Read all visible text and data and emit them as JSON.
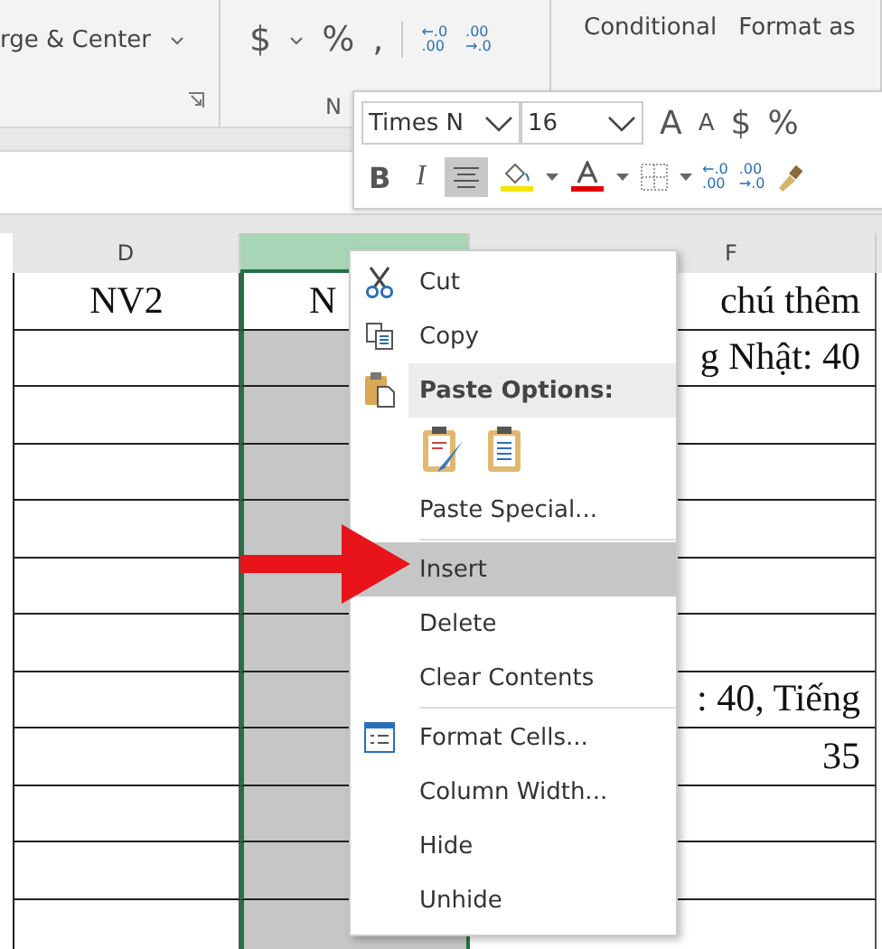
{
  "ribbon": {
    "merge_label": "rge & Center",
    "currency": "$",
    "percent": "%",
    "comma": ",",
    "decimals": [
      {
        "top": "←.0",
        "bottom": ".00"
      },
      {
        "top": ".00",
        "bottom": "→.0"
      }
    ],
    "group_label": "N",
    "styles": [
      "Conditional",
      "Format as"
    ]
  },
  "mini_toolbar": {
    "font": "Times N",
    "size": "16",
    "grow": "A",
    "shrink": "A",
    "currency": "$",
    "percent": "%",
    "bold": "B",
    "italic": "I",
    "align_selected": true,
    "decimals": [
      {
        "top": "←.0",
        "bottom": ".00"
      },
      {
        "top": ".00",
        "bottom": "→.0"
      }
    ]
  },
  "sheet": {
    "columns": [
      {
        "label": "D",
        "selected": false
      },
      {
        "selected": true
      },
      {
        "label": "F",
        "selected": false
      }
    ],
    "rows": [
      [
        "NV2",
        "N",
        "chú thêm"
      ],
      [
        "",
        "",
        "g Nhật: 40"
      ],
      [
        "",
        "",
        ""
      ],
      [
        "",
        "",
        ""
      ],
      [
        "",
        "",
        ""
      ],
      [
        "",
        "",
        ""
      ],
      [
        "",
        "",
        ""
      ],
      [
        "",
        "",
        ": 40, Tiếng"
      ],
      [
        "",
        "",
        "35"
      ],
      [
        "",
        "",
        ""
      ],
      [
        "",
        "",
        ""
      ],
      [
        "",
        "",
        ""
      ]
    ]
  },
  "context_menu": {
    "items": [
      {
        "kind": "cut",
        "label": "Cut",
        "selected": false
      },
      {
        "kind": "copy",
        "label": "Copy",
        "selected": false
      },
      {
        "kind": "header",
        "label": "Paste Options:"
      },
      {
        "kind": "paste_icons"
      },
      {
        "kind": "command",
        "label": "Paste Special...",
        "selected": false
      },
      {
        "kind": "separator"
      },
      {
        "kind": "command",
        "label": "Insert",
        "selected": true
      },
      {
        "kind": "command",
        "label": "Delete",
        "selected": false
      },
      {
        "kind": "command",
        "label": "Clear Contents",
        "selected": false
      },
      {
        "kind": "separator"
      },
      {
        "kind": "format",
        "label": "Format Cells...",
        "selected": false
      },
      {
        "kind": "command",
        "label": "Column Width...",
        "selected": false
      },
      {
        "kind": "command",
        "label": "Hide",
        "selected": false
      },
      {
        "kind": "command",
        "label": "Unhide",
        "selected": false
      }
    ]
  }
}
